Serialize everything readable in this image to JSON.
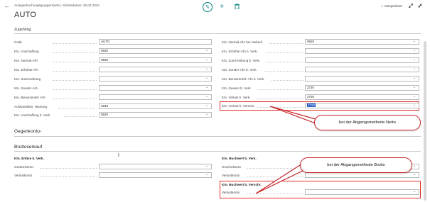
{
  "header": {
    "breadcrumb": "Anlagenbuchungsgruppenkarte | Arbeitsdatum: 30.04.2022",
    "title": "AUTO",
    "saved_label": "Gespeichert",
    "saved_check": "✓"
  },
  "sections": {
    "general": "Zugehörig",
    "gegenkonto": "Gegenkonto",
    "bruttoverkauf": "Bruttoverkauf"
  },
  "left_fields": [
    {
      "label": "Code",
      "value": "AUTO"
    },
    {
      "label": "Kto. Anschaffung",
      "value": "0520"
    },
    {
      "label": "Kto. Normal-AfA",
      "value": "0520"
    },
    {
      "label": "Kto. Erhöhte AfA",
      "value": ""
    },
    {
      "label": "Kto. Zuschreibung",
      "value": ""
    },
    {
      "label": "Kto. Sonder-AfA",
      "value": ""
    },
    {
      "label": "Kto. Benutzerdef. AfA",
      "value": ""
    },
    {
      "label": "Aufwandskto. Wartung",
      "value": "4540"
    },
    {
      "label": "Kto. Anschaffung b. Verk.",
      "value": "0520"
    }
  ],
  "right_fields": [
    {
      "label": "Kto. Normal-AfA bei Verkauf",
      "value": "0520"
    },
    {
      "label": "Kto. Erhöhte AfA b. Verk.",
      "value": ""
    },
    {
      "label": "Kto. Zuschreibung b. Verk.",
      "value": ""
    },
    {
      "label": "Kto. Sonder-AfA b. Verk.",
      "value": ""
    },
    {
      "label": "Kto. Benutzerdef. AfA b. Verk.",
      "value": ""
    },
    {
      "label": "Kto. Gewinn b. Verk.",
      "value": "2720"
    },
    {
      "label": "Kto. Verlust b. Verk.",
      "value": "2720"
    },
    {
      "label": "Kto. Verlust b. Verschr.",
      "value": "2720"
    }
  ],
  "brutto": {
    "left_group": "Kto. Erlöse b. Verk.",
    "left_fields": [
      {
        "label": "Gewinnkonto",
        "value": ""
      },
      {
        "label": "Verlustkonto",
        "value": ""
      }
    ],
    "right_group": "Kto. Buchwert b. Verk.",
    "right_fields": [
      {
        "label": "Gewinnkonto",
        "value": ""
      },
      {
        "label": "Verlustkonto",
        "value": ""
      }
    ],
    "right_group2": "Kto. Buchwert b. Verschr.",
    "right_fields2": [
      {
        "label": "Verlustkonto",
        "value": ""
      }
    ]
  },
  "callouts": {
    "netto": "bei der Abgangsmethode Netto",
    "brutto": "bei der Abgangsmethode Brutto"
  },
  "icons": {
    "back": "←",
    "edit": "✎",
    "add": "+",
    "delete": "🗑",
    "expand": "⤢",
    "collapse": "⤡",
    "chevron": "⌄",
    "gegen_chevron": "›",
    "cursor": "I"
  },
  "colors": {
    "accent": "#00827f",
    "highlight": "#e0302a",
    "selected_value_bg": "#1f56c6"
  }
}
